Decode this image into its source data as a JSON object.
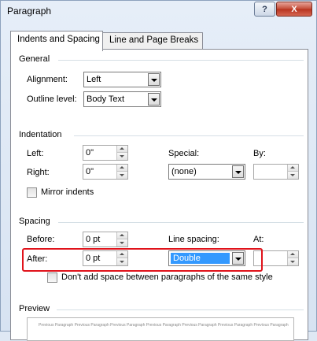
{
  "window": {
    "title": "Paragraph",
    "help_label": "?",
    "close_label": "X"
  },
  "tabs": [
    {
      "label": "Indents and Spacing",
      "active": true
    },
    {
      "label": "Line and Page Breaks",
      "active": false
    }
  ],
  "general": {
    "title": "General",
    "alignment_label": "Alignment:",
    "alignment_value": "Left",
    "outline_label": "Outline level:",
    "outline_value": "Body Text"
  },
  "indentation": {
    "title": "Indentation",
    "left_label": "Left:",
    "left_value": "0\"",
    "right_label": "Right:",
    "right_value": "0\"",
    "special_label": "Special:",
    "special_value": "(none)",
    "by_label": "By:",
    "by_value": "",
    "mirror_label": "Mirror indents",
    "mirror_checked": false
  },
  "spacing": {
    "title": "Spacing",
    "before_label": "Before:",
    "before_value": "0 pt",
    "after_label": "After:",
    "after_value": "0 pt",
    "line_spacing_label": "Line spacing:",
    "line_spacing_value": "Double",
    "at_label": "At:",
    "at_value": "",
    "dont_add_label": "Don't add space between paragraphs of the same style",
    "dont_add_checked": false
  },
  "preview": {
    "title": "Preview",
    "sample_text": "Previous Paragraph Previous Paragraph Previous Paragraph Previous Paragraph Previous Paragraph Previous Paragraph Previous Paragraph"
  },
  "colors": {
    "highlight_border": "#e0131b",
    "selection": "#3399ff"
  }
}
